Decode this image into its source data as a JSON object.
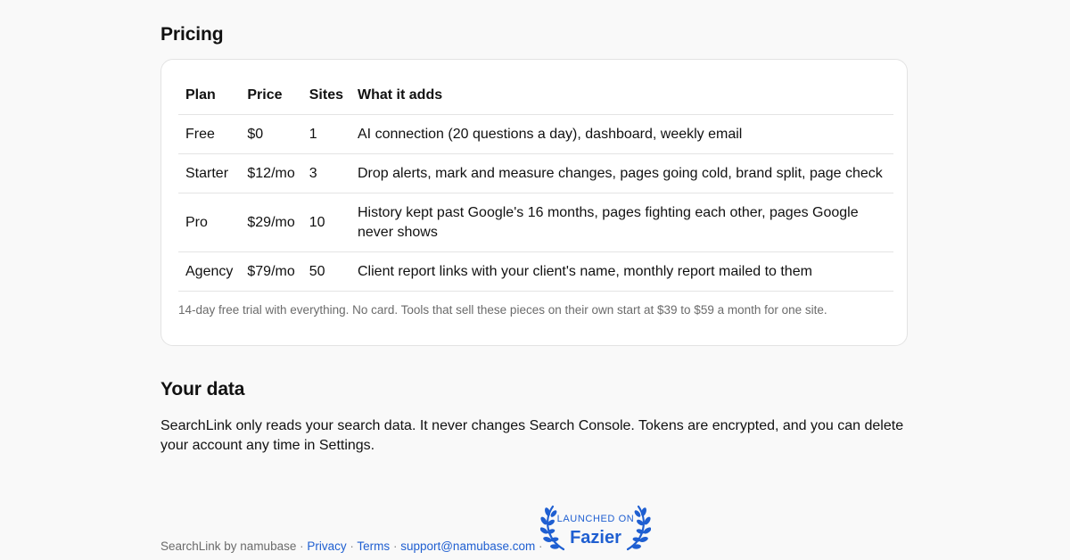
{
  "pricing": {
    "heading": "Pricing",
    "columns": [
      "Plan",
      "Price",
      "Sites",
      "What it adds"
    ],
    "rows": [
      {
        "plan": "Free",
        "price": "$0",
        "sites": "1",
        "adds": "AI connection (20 questions a day), dashboard, weekly email"
      },
      {
        "plan": "Starter",
        "price": "$12/mo",
        "sites": "3",
        "adds": "Drop alerts, mark and measure changes, pages going cold, brand split, page check"
      },
      {
        "plan": "Pro",
        "price": "$29/mo",
        "sites": "10",
        "adds": "History kept past Google's 16 months, pages fighting each other, pages Google never shows"
      },
      {
        "plan": "Agency",
        "price": "$79/mo",
        "sites": "50",
        "adds": "Client report links with your client's name, monthly report mailed to them"
      }
    ],
    "note": "14-day free trial with everything. No card. Tools that sell these pieces on their own start at $39 to $59 a month for one site."
  },
  "your_data": {
    "heading": "Your data",
    "text": "SearchLink only reads your search data. It never changes Search Console. Tokens are encrypted, and you can delete your account any time in Settings."
  },
  "footer": {
    "brand": "SearchLink by namubase",
    "separator": "·",
    "links": {
      "privacy": "Privacy",
      "terms": "Terms",
      "support": "support@namubase.com"
    }
  },
  "badge": {
    "top_text": "LAUNCHED ON",
    "name": "Fazier",
    "icon": "laurel-wreath-icon"
  },
  "colors": {
    "link": "#1f5fd1",
    "background": "#f9f9f9",
    "card": "#ffffff",
    "muted_text": "#6b6b6b"
  }
}
